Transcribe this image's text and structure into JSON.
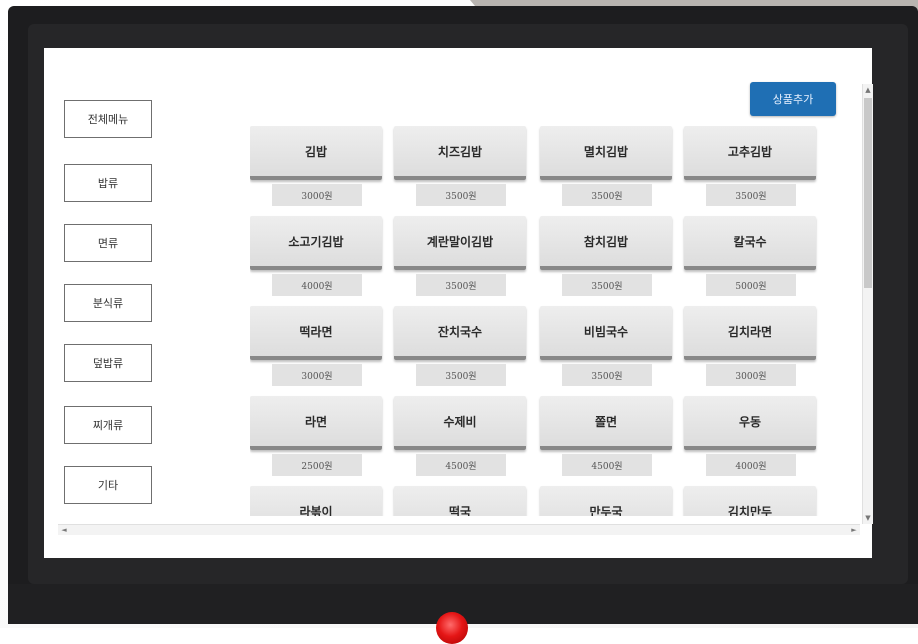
{
  "sidebar": {
    "categories": [
      "전체메뉴",
      "밥류",
      "면류",
      "분식류",
      "덮밥류",
      "찌개류",
      "기타"
    ]
  },
  "toolbar": {
    "add_product_label": "상품추가"
  },
  "menu": {
    "items": [
      {
        "name": "김밥",
        "price": "3000원"
      },
      {
        "name": "치즈김밥",
        "price": "3500원"
      },
      {
        "name": "멸치김밥",
        "price": "3500원"
      },
      {
        "name": "고추김밥",
        "price": "3500원"
      },
      {
        "name": "소고기김밥",
        "price": "4000원"
      },
      {
        "name": "계란말이김밥",
        "price": "3500원"
      },
      {
        "name": "참치김밥",
        "price": "3500원"
      },
      {
        "name": "칼국수",
        "price": "5000원"
      },
      {
        "name": "떡라면",
        "price": "3000원"
      },
      {
        "name": "잔치국수",
        "price": "3500원"
      },
      {
        "name": "비빔국수",
        "price": "3500원"
      },
      {
        "name": "김치라면",
        "price": "3000원"
      },
      {
        "name": "라면",
        "price": "2500원"
      },
      {
        "name": "수제비",
        "price": "4500원"
      },
      {
        "name": "쫄면",
        "price": "4500원"
      },
      {
        "name": "우동",
        "price": "4000원"
      },
      {
        "name": "라볶이",
        "price": ""
      },
      {
        "name": "떡국",
        "price": ""
      },
      {
        "name": "만두국",
        "price": ""
      },
      {
        "name": "김치만두",
        "price": ""
      }
    ]
  },
  "scrollbars": {
    "up_icon": "▲",
    "down_icon": "▼",
    "left_icon": "◄",
    "right_icon": "►"
  },
  "colors": {
    "accent": "#1f6fb4",
    "bezel": "#1d1d1f",
    "power_led": "#e51616"
  }
}
